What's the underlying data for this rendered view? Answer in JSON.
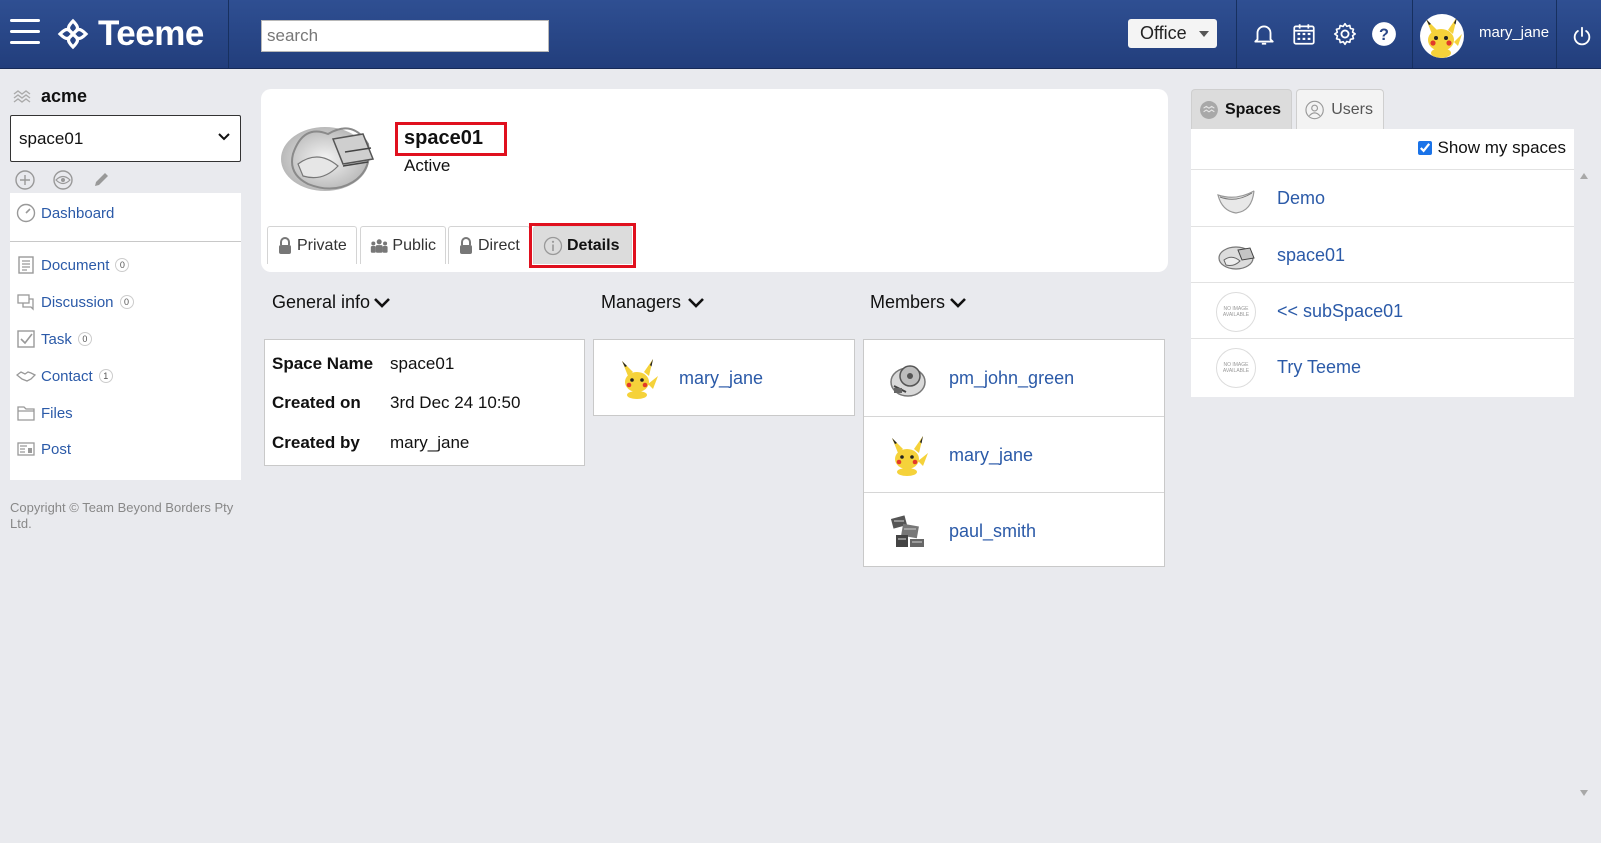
{
  "header": {
    "app_name": "Teeme",
    "search_placeholder": "search",
    "office_label": "Office",
    "username": "mary_jane"
  },
  "sidebar": {
    "org_name": "acme",
    "selected_space": "space01",
    "items": [
      {
        "label": "Dashboard",
        "icon": "dashboard-icon"
      },
      {
        "label": "Document",
        "count": "0",
        "icon": "document-icon"
      },
      {
        "label": "Discussion",
        "count": "0",
        "icon": "discussion-icon"
      },
      {
        "label": "Task",
        "count": "0",
        "icon": "task-icon"
      },
      {
        "label": "Contact",
        "count": "1",
        "icon": "contact-icon"
      },
      {
        "label": "Files",
        "icon": "files-icon"
      },
      {
        "label": "Post",
        "icon": "post-icon"
      }
    ],
    "copyright": "Copyright © Team Beyond Borders Pty Ltd."
  },
  "space": {
    "name": "space01",
    "status": "Active",
    "tabs": [
      "Private",
      "Public",
      "Direct",
      "Details"
    ],
    "active_tab": "Details"
  },
  "sections": {
    "general_info": "General info",
    "managers": "Managers",
    "members": "Members"
  },
  "general_info": {
    "rows": [
      {
        "key": "Space Name",
        "value": "space01"
      },
      {
        "key": "Created on",
        "value": "3rd Dec 24 10:50"
      },
      {
        "key": "Created by",
        "value": "mary_jane"
      }
    ]
  },
  "managers": [
    "mary_jane"
  ],
  "members": [
    "pm_john_green",
    "mary_jane",
    "paul_smith"
  ],
  "right_panel": {
    "tabs": [
      "Spaces",
      "Users"
    ],
    "active_tab": "Spaces",
    "show_my_spaces_label": "Show my spaces",
    "show_my_spaces_checked": true,
    "spaces": [
      "Demo",
      "space01",
      "<< subSpace01",
      "Try Teeme"
    ],
    "no_image_text": "NO IMAGE AVAILABLE"
  },
  "colors": {
    "header": "#2a4788",
    "link": "#2b5aa8",
    "highlight": "#e0101e"
  }
}
